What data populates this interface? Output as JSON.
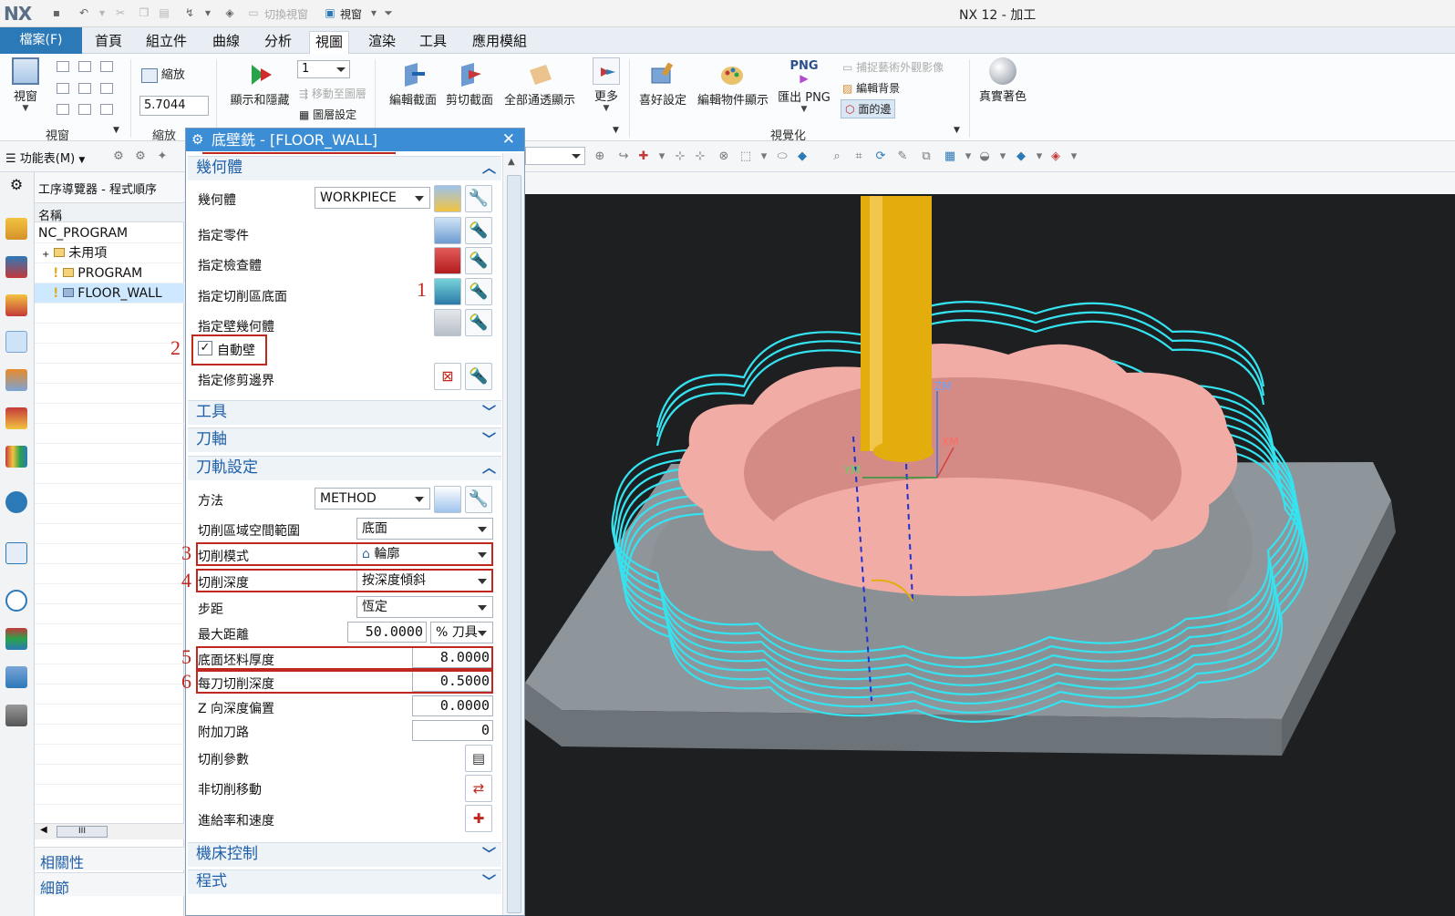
{
  "app": {
    "logo": "NX",
    "window_title": "NX 12 - 加工",
    "quick_access": {
      "switch_window": "切換視窗",
      "window_menu": "視窗"
    }
  },
  "tabs": [
    "檔案(F)",
    "首頁",
    "組立件",
    "曲線",
    "分析",
    "視圖",
    "渲染",
    "工具",
    "應用模組"
  ],
  "active_tab": "視圖",
  "ribbon": {
    "window_group": {
      "button": "視窗",
      "label": "視窗"
    },
    "zoom_group": {
      "button": "縮放",
      "value": "5.7044",
      "label": "縮放"
    },
    "visibility_group": {
      "show_hide": "顯示和隱藏",
      "layer_value": "1",
      "move_to_layer": "移動至圖層",
      "layer_settings": "圖層設定"
    },
    "section_group": {
      "edit_section": "編輯截面",
      "clip_section": "剪切截面",
      "all_transparent": "全部通透顯示",
      "more": "更多"
    },
    "visualization_group": {
      "preferences": "喜好設定",
      "edit_object_display": "編輯物件顯示",
      "png_badge": "PNG",
      "export_png": "匯出 PNG",
      "capture_image": "捕捉藝術外觀影像",
      "edit_background": "編輯背景",
      "face_edges": "面的邊",
      "label": "視覺化"
    },
    "true_shading": "真實著色"
  },
  "toolbar2": {
    "menu_label": "功能表(M)"
  },
  "navigator": {
    "title": "工序導覽器 - 程式順序",
    "column": "名稱",
    "rows": [
      "NC_PROGRAM",
      "未用項",
      "PROGRAM",
      "FLOOR_WALL"
    ],
    "bottom_panels": [
      "相關性",
      "細節"
    ],
    "scroll_grip": "III"
  },
  "dialog": {
    "title": "底壁銑 - [FLOOR_WALL]",
    "close": "✕",
    "sections": {
      "geometry": "幾何體",
      "tool": "工具",
      "axis": "刀軸",
      "path_settings": "刀軌設定",
      "machine_control": "機床控制",
      "program": "程式"
    },
    "geometry": {
      "geometry_label": "幾何體",
      "geometry_value": "WORKPIECE",
      "specify_part": "指定零件",
      "specify_check": "指定檢查體",
      "specify_floor": "指定切削區底面",
      "specify_wall": "指定壁幾何體",
      "auto_wall": "自動壁",
      "auto_wall_checked": true,
      "specify_trim": "指定修剪邊界"
    },
    "path": {
      "method_label": "方法",
      "method_value": "METHOD",
      "cut_area_label": "切削區域空間範圍",
      "cut_area_value": "底面",
      "cut_pattern_label": "切削模式",
      "cut_pattern_value": "輪廓",
      "cut_depth_label": "切削深度",
      "cut_depth_value": "按深度傾斜",
      "stepover_label": "步距",
      "stepover_value": "恆定",
      "max_distance_label": "最大距離",
      "max_distance_value": "50.0000",
      "max_distance_unit": "% 刀具",
      "floor_stock_label": "底面坯料厚度",
      "floor_stock_value": "8.0000",
      "depth_per_cut_label": "每刀切削深度",
      "depth_per_cut_value": "0.5000",
      "z_offset_label": "Z 向深度偏置",
      "z_offset_value": "0.0000",
      "additional_passes_label": "附加刀路",
      "additional_passes_value": "0",
      "cutting_params": "切削參數",
      "non_cutting_moves": "非切削移動",
      "feeds_speeds": "進給率和速度"
    },
    "annotations": [
      "1",
      "2",
      "3",
      "4",
      "5",
      "6"
    ]
  },
  "viewport": {
    "axis_labels": {
      "zm": "ZM",
      "xm": "XM",
      "ym": "YM"
    }
  },
  "colors": {
    "accent": "#3b8ed5",
    "file_tab": "#2c79b8",
    "annotation_red": "#c0281f",
    "toolpath_cyan": "#35e3f0",
    "part_pink": "#f2aca6",
    "tool_yellow": "#e3ad0e",
    "plate_gray": "#9aa0a4"
  }
}
